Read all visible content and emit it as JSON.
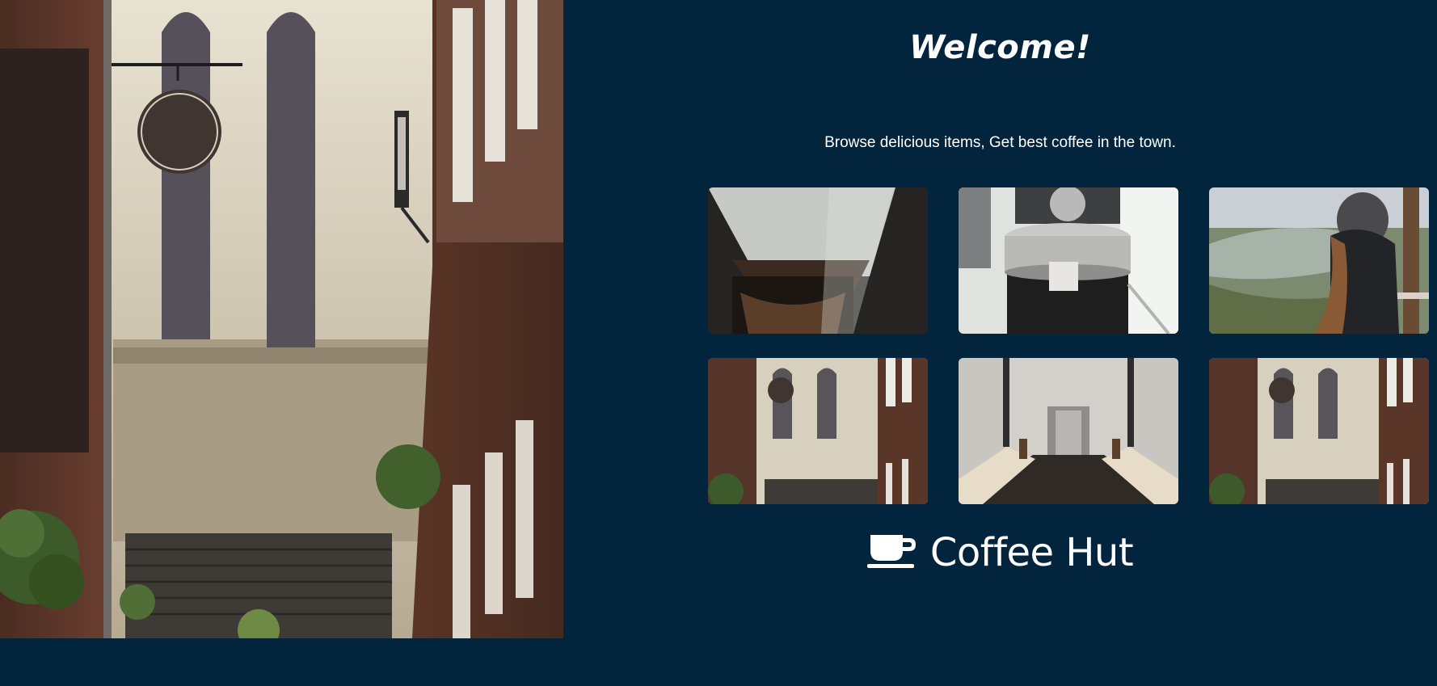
{
  "header": {
    "title": "Welcome!",
    "tagline": "Browse delicious items, Get best coffee in the town."
  },
  "gallery": {
    "items": [
      {
        "name": "pour-over brewer",
        "icon": "photo"
      },
      {
        "name": "coffee roaster",
        "icon": "photo"
      },
      {
        "name": "woman overlooking valley",
        "icon": "photo"
      },
      {
        "name": "street with cafe sign",
        "icon": "photo"
      },
      {
        "name": "cafe interior",
        "icon": "photo"
      },
      {
        "name": "street with cafe sign",
        "icon": "photo"
      }
    ]
  },
  "brand": {
    "name": "Coffee Hut",
    "icon": "coffee-cup-icon"
  },
  "colors": {
    "background": "#03243d",
    "text": "#ffffff"
  }
}
